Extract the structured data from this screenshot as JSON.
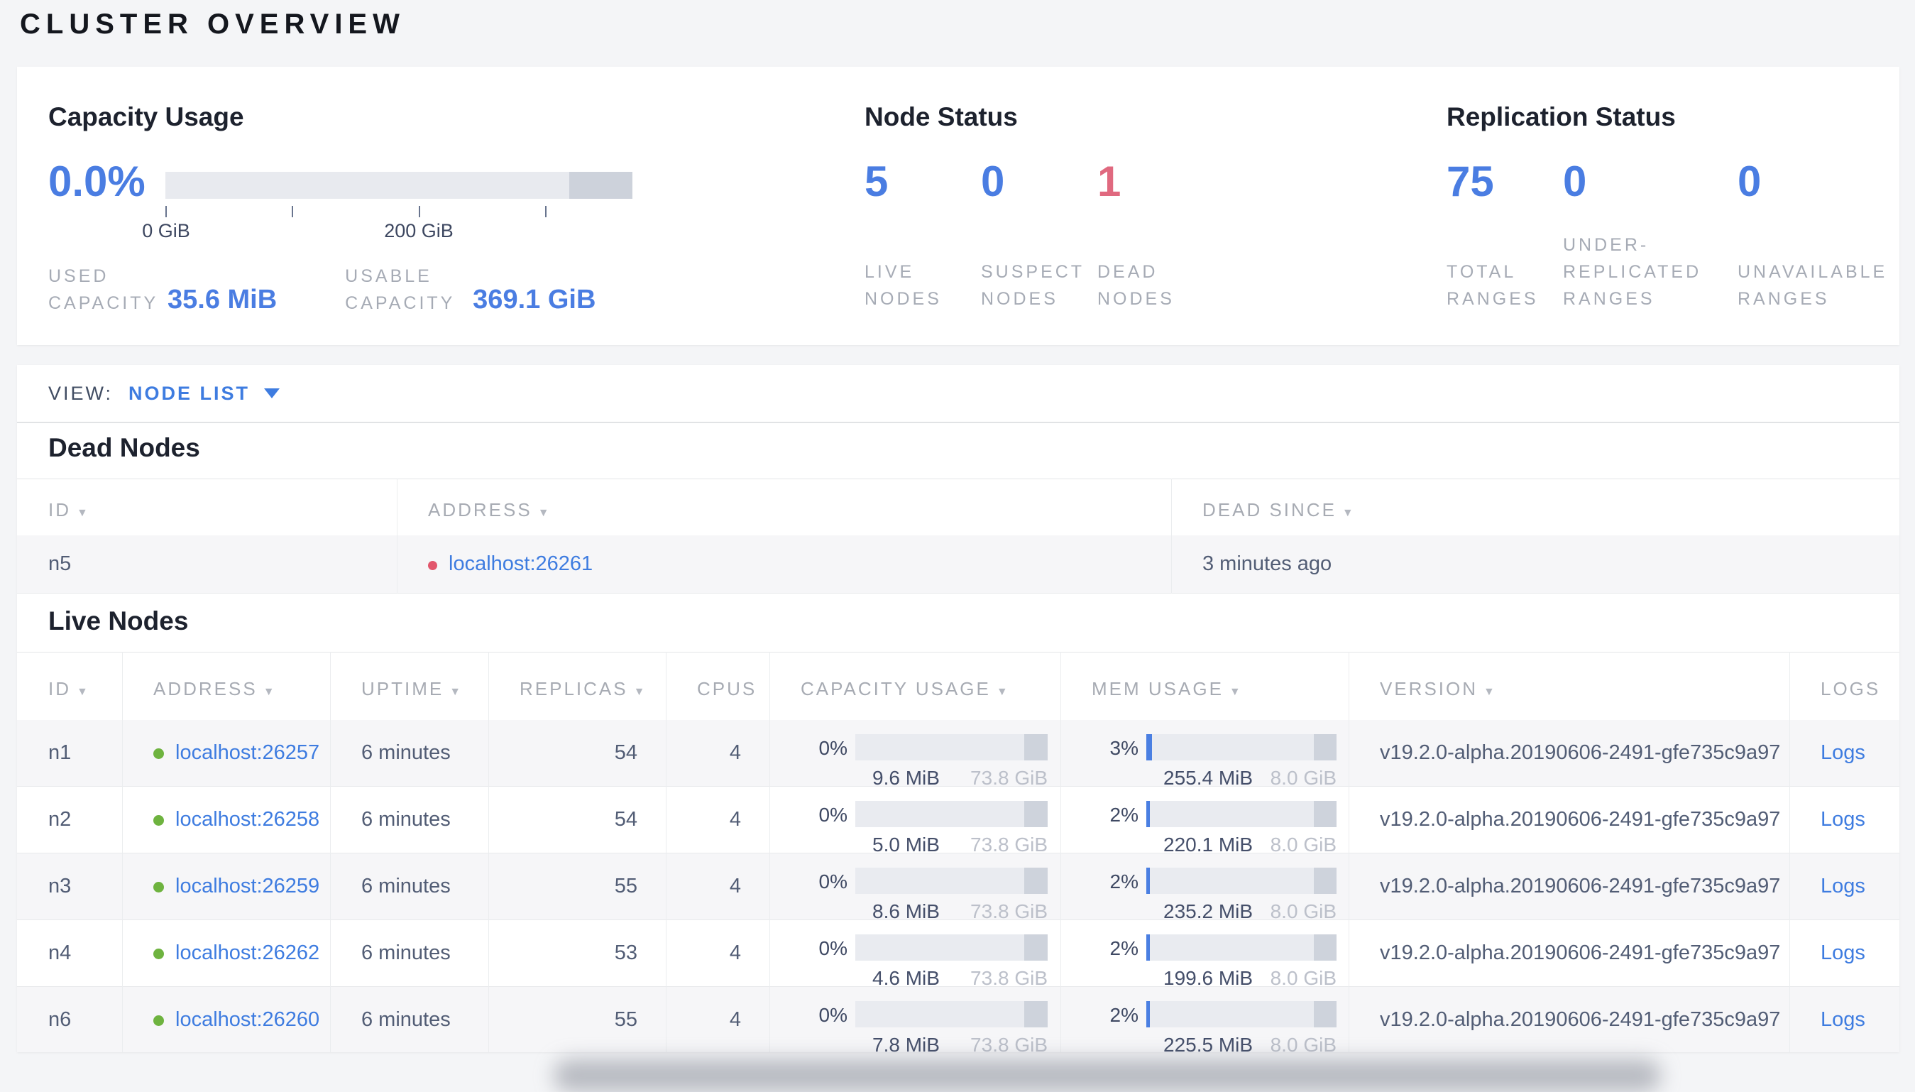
{
  "page_title": "CLUSTER OVERVIEW",
  "colors": {
    "accent_blue": "#4a7de2",
    "danger_red": "#e0697f",
    "live_green": "#6eb33f",
    "dead_red": "#e2566c"
  },
  "capacity": {
    "title": "Capacity Usage",
    "percent": "0.0%",
    "bar": {
      "fill_pct": 0,
      "secondary_pct": 13.5
    },
    "tick_labels": {
      "start": "0 GiB",
      "middle": "200 GiB"
    },
    "used": {
      "label_line1": "USED",
      "label_line2": "CAPACITY",
      "value": "35.6 MiB"
    },
    "usable": {
      "label_line1": "USABLE",
      "label_line2": "CAPACITY",
      "value": "369.1 GiB"
    }
  },
  "node_status": {
    "title": "Node Status",
    "stats": [
      {
        "value": "5",
        "label_line1": "LIVE",
        "label_line2": "NODES"
      },
      {
        "value": "0",
        "label_line1": "SUSPECT",
        "label_line2": "NODES"
      },
      {
        "value": "1",
        "label_line1": "DEAD",
        "label_line2": "NODES"
      }
    ]
  },
  "replication": {
    "title": "Replication Status",
    "stats": [
      {
        "value": "75",
        "label_line1": "TOTAL",
        "label_line2": "RANGES"
      },
      {
        "value": "0",
        "label_line1": "UNDER-",
        "label_line2": "REPLICATED",
        "label_line3": "RANGES"
      },
      {
        "value": "0",
        "label_line1": "UNAVAILABLE",
        "label_line2": "RANGES"
      }
    ]
  },
  "view_bar": {
    "label": "VIEW:",
    "selected": "NODE LIST"
  },
  "dead_nodes": {
    "heading": "Dead Nodes",
    "columns": {
      "id": "ID",
      "address": "ADDRESS",
      "dead_since": "DEAD SINCE"
    },
    "rows": [
      {
        "id": "n5",
        "address": "localhost:26261",
        "dead_since": "3 minutes ago"
      }
    ]
  },
  "live_nodes": {
    "heading": "Live Nodes",
    "columns": {
      "id": "ID",
      "address": "ADDRESS",
      "uptime": "UPTIME",
      "replicas": "REPLICAS",
      "cpus": "CPUS",
      "capacity": "CAPACITY USAGE",
      "mem": "MEM USAGE",
      "version": "VERSION",
      "logs": "LOGS"
    },
    "rows": [
      {
        "id": "n1",
        "address": "localhost:26257",
        "uptime": "6 minutes",
        "replicas": "54",
        "cpus": "4",
        "capacity": {
          "percent": "0%",
          "fill_pct": 0,
          "used": "9.6 MiB",
          "total": "73.8 GiB"
        },
        "mem": {
          "percent": "3%",
          "fill_pct": 3,
          "used": "255.4 MiB",
          "total": "8.0 GiB"
        },
        "version": "v19.2.0-alpha.20190606-2491-gfe735c9a97",
        "logs": "Logs"
      },
      {
        "id": "n2",
        "address": "localhost:26258",
        "uptime": "6 minutes",
        "replicas": "54",
        "cpus": "4",
        "capacity": {
          "percent": "0%",
          "fill_pct": 0,
          "used": "5.0 MiB",
          "total": "73.8 GiB"
        },
        "mem": {
          "percent": "2%",
          "fill_pct": 2,
          "used": "220.1 MiB",
          "total": "8.0 GiB"
        },
        "version": "v19.2.0-alpha.20190606-2491-gfe735c9a97",
        "logs": "Logs"
      },
      {
        "id": "n3",
        "address": "localhost:26259",
        "uptime": "6 minutes",
        "replicas": "55",
        "cpus": "4",
        "capacity": {
          "percent": "0%",
          "fill_pct": 0,
          "used": "8.6 MiB",
          "total": "73.8 GiB"
        },
        "mem": {
          "percent": "2%",
          "fill_pct": 2,
          "used": "235.2 MiB",
          "total": "8.0 GiB"
        },
        "version": "v19.2.0-alpha.20190606-2491-gfe735c9a97",
        "logs": "Logs"
      },
      {
        "id": "n4",
        "address": "localhost:26262",
        "uptime": "6 minutes",
        "replicas": "53",
        "cpus": "4",
        "capacity": {
          "percent": "0%",
          "fill_pct": 0,
          "used": "4.6 MiB",
          "total": "73.8 GiB"
        },
        "mem": {
          "percent": "2%",
          "fill_pct": 2,
          "used": "199.6 MiB",
          "total": "8.0 GiB"
        },
        "version": "v19.2.0-alpha.20190606-2491-gfe735c9a97",
        "logs": "Logs"
      },
      {
        "id": "n6",
        "address": "localhost:26260",
        "uptime": "6 minutes",
        "replicas": "55",
        "cpus": "4",
        "capacity": {
          "percent": "0%",
          "fill_pct": 0,
          "used": "7.8 MiB",
          "total": "73.8 GiB"
        },
        "mem": {
          "percent": "2%",
          "fill_pct": 2,
          "used": "225.5 MiB",
          "total": "8.0 GiB"
        },
        "version": "v19.2.0-alpha.20190606-2491-gfe735c9a97",
        "logs": "Logs"
      }
    ]
  }
}
